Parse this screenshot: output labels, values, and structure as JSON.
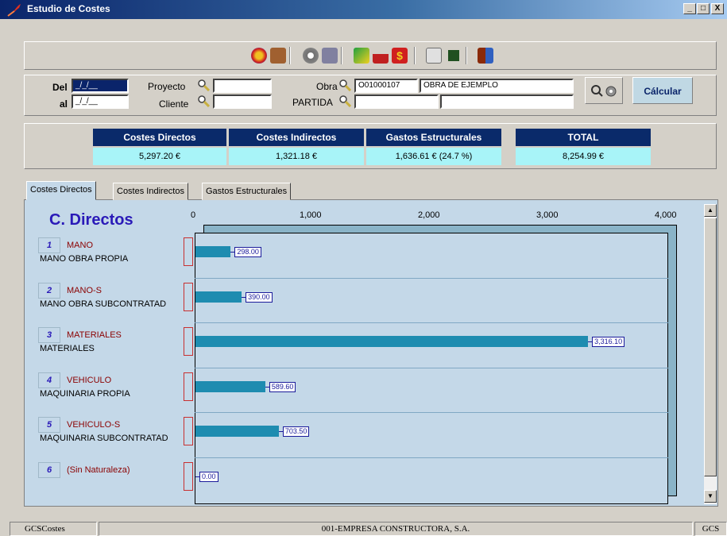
{
  "window": {
    "title": "Estudio de Costes",
    "min": "_",
    "max": "□",
    "close": "X"
  },
  "filters": {
    "del_label": "Del",
    "al_label": "al",
    "del_value": "_/_/__",
    "al_value": "_/_/__",
    "proyecto_label": "Proyecto",
    "cliente_label": "Cliente",
    "obra_label": "Obra",
    "obra_code": "O01000107",
    "obra_name": "OBRA DE EJEMPLO",
    "partida_label": "PARTIDA",
    "calcular_label": "Cálcular"
  },
  "totals": [
    {
      "header": "Costes Directos",
      "value": "5,297.20 €"
    },
    {
      "header": "Costes Indirectos",
      "value": "1,321.18 €"
    },
    {
      "header": "Gastos Estructurales",
      "value": "1,636.61 €  (24.7 %)"
    },
    {
      "header": "TOTAL",
      "value": "8,254.99 €"
    }
  ],
  "tabs": [
    "Costes Directos",
    "Costes Indirectos",
    "Gastos Estructurales"
  ],
  "chart_data": {
    "type": "bar",
    "title": "C. Directos",
    "orientation": "horizontal",
    "xlim": [
      0,
      4000
    ],
    "ticks": [
      "0",
      "1,000",
      "2,000",
      "3,000",
      "4,000"
    ],
    "tick_values": [
      0,
      1000,
      2000,
      3000,
      4000
    ],
    "rows": [
      {
        "num": "1",
        "code": "MANO",
        "desc": "MANO OBRA PROPIA",
        "value": 298.0,
        "label": "298.00"
      },
      {
        "num": "2",
        "code": "MANO-S",
        "desc": "MANO OBRA SUBCONTRATAD",
        "value": 390.0,
        "label": "390.00"
      },
      {
        "num": "3",
        "code": "MATERIALES",
        "desc": "MATERIALES",
        "value": 3316.1,
        "label": "3,316.10"
      },
      {
        "num": "4",
        "code": "VEHICULO",
        "desc": "MAQUINARIA PROPIA",
        "value": 589.6,
        "label": "589.60"
      },
      {
        "num": "5",
        "code": "VEHICULO-S",
        "desc": "MAQUINARIA SUBCONTRATAD",
        "value": 703.5,
        "label": "703.50"
      },
      {
        "num": "6",
        "code": "(Sin Naturaleza)",
        "desc": "",
        "value": 0.0,
        "label": "0.00"
      }
    ],
    "bar_color": "#1e8cb0"
  },
  "status": {
    "left": "GCSCostes",
    "center": "001-EMPRESA CONSTRUCTORA, S.A.",
    "right": "GCS"
  }
}
